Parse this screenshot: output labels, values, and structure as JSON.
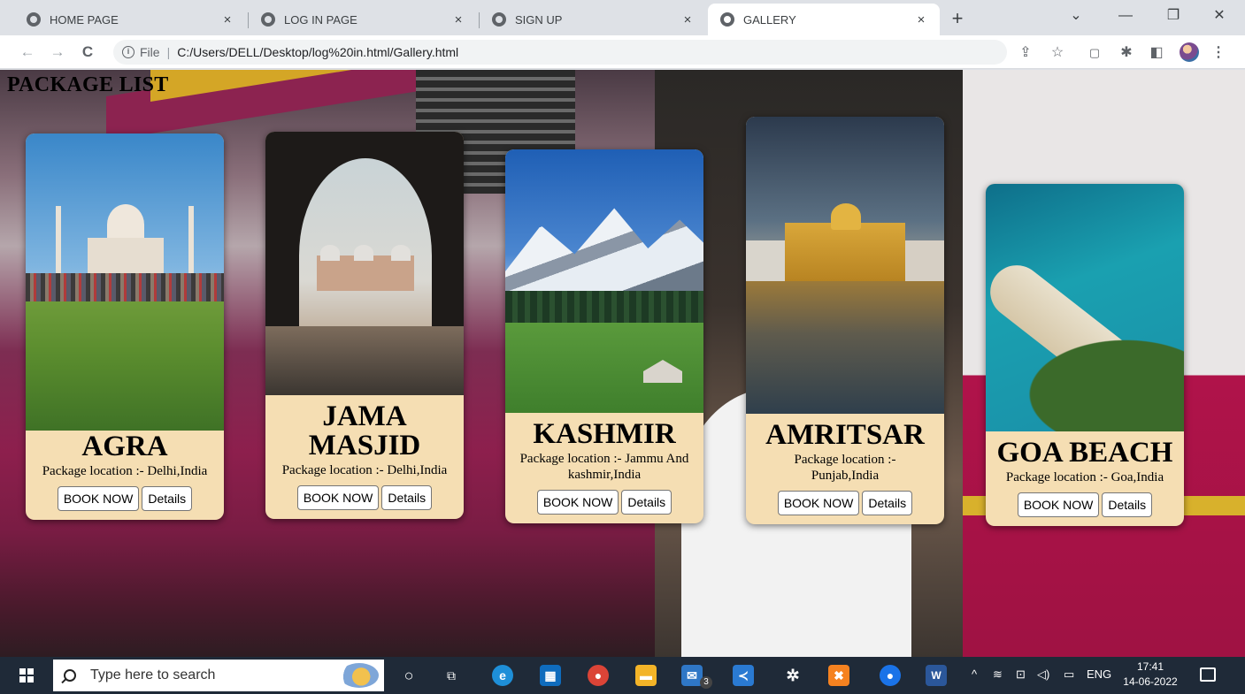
{
  "browser": {
    "tabs": [
      {
        "title": "HOME PAGE",
        "close": "×"
      },
      {
        "title": "LOG IN PAGE",
        "close": "×"
      },
      {
        "title": "SIGN UP",
        "close": "×"
      },
      {
        "title": "GALLERY",
        "close": "×",
        "active": true
      }
    ],
    "new_tab": "+",
    "window_controls": {
      "dropdown": "⌄",
      "minimize": "—",
      "restore": "❐",
      "close": "✕"
    },
    "nav": {
      "back": "←",
      "forward": "→",
      "reload": "C"
    },
    "address": {
      "scheme_label": "File",
      "url": "C:/Users/DELL/Desktop/log%20in.html/Gallery.html"
    },
    "toolbar_icons": [
      "share-icon",
      "star-icon",
      "pocket-icon",
      "extensions-icon",
      "sidepanel-icon",
      "profile-avatar",
      "menu-icon"
    ]
  },
  "page": {
    "heading": "PACKAGE LIST",
    "cards": [
      {
        "title": "AGRA",
        "location": "Package location :- Delhi,India",
        "book": "BOOK NOW",
        "details": "Details"
      },
      {
        "title": "JAMA MASJID",
        "location": "Package location :- Delhi,India",
        "book": "BOOK NOW",
        "details": "Details"
      },
      {
        "title": "KASHMIR",
        "location": "Package location :- Jammu And kashmir,India",
        "book": "BOOK NOW",
        "details": "Details"
      },
      {
        "title": "AMRITSAR",
        "location": "Package location :- Punjab,India",
        "book": "BOOK NOW",
        "details": "Details"
      },
      {
        "title": "GOA BEACH",
        "location": "Package location :- Goa,India",
        "book": "BOOK NOW",
        "details": "Details"
      }
    ],
    "card_color": "#f5deb3"
  },
  "taskbar": {
    "search_placeholder": "Type here to search",
    "tray": {
      "language": "ENG",
      "time": "17:41",
      "date": "14-06-2022",
      "mail_badge": "3"
    }
  }
}
